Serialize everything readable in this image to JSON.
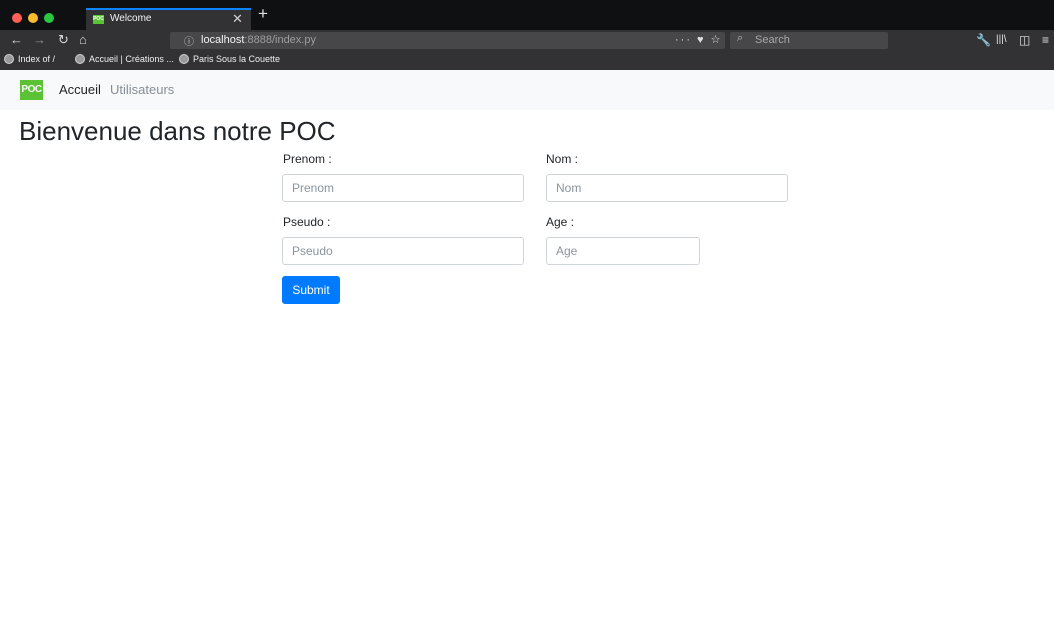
{
  "browser": {
    "tab": {
      "favicon_text": "POC",
      "title": "Welcome",
      "close": "✕",
      "new_tab": "+"
    },
    "nav": {
      "back": "←",
      "forward": "→",
      "reload": "↻",
      "home": "⌂"
    },
    "url": {
      "info_icon": "ⓘ",
      "host": "localhost",
      "rest": ":8888/index.py",
      "actions": "··· ♥ ☆"
    },
    "search": {
      "icon": "⌕",
      "placeholder": "Search"
    },
    "toolbar": {
      "tools": "🔧",
      "library": "|||\\",
      "sidebar": "◫",
      "menu": "≡"
    },
    "bookmarks": [
      "Index of /",
      "Accueil | Créations ...",
      "Paris Sous la Couette"
    ]
  },
  "site": {
    "brand": "POC",
    "nav": {
      "home": "Accueil",
      "users": "Utilisateurs"
    },
    "title": "Bienvenue dans notre POC",
    "form": {
      "prenom_label": "Prenom :",
      "prenom_placeholder": "Prenom",
      "nom_label": "Nom :",
      "nom_placeholder": "Nom",
      "pseudo_label": "Pseudo :",
      "pseudo_placeholder": "Pseudo",
      "age_label": "Age :",
      "age_placeholder": "Age",
      "submit": "Submit"
    }
  },
  "colors": {
    "primary": "#007bff",
    "brand": "#5bc236",
    "accent_tab": "#0a84ff"
  }
}
